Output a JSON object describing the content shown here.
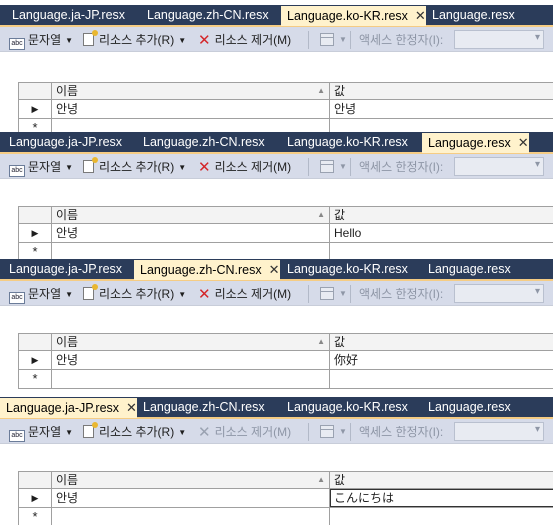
{
  "toolbar": {
    "strings_label": "문자열",
    "add_resource_label": "리소스 추가(R)",
    "remove_resource_label": "리소스 제거(M)",
    "access_modifier_label": "액세스 한정자(I):"
  },
  "grid": {
    "col_name": "이름",
    "col_value": "값",
    "new_row_marker": "*",
    "current_row_marker": "▶"
  },
  "panels": [
    {
      "tabs": [
        "Language.ja-JP.resx",
        "Language.zh-CN.resx",
        "Language.ko-KR.resx",
        "Language.resx"
      ],
      "active_tab": "Language.ko-KR.resx",
      "row": {
        "name": "안녕",
        "value": "안녕"
      },
      "remove_enabled": true
    },
    {
      "tabs": [
        "Language.ja-JP.resx",
        "Language.zh-CN.resx",
        "Language.ko-KR.resx",
        "Language.resx"
      ],
      "active_tab": "Language.resx",
      "row": {
        "name": "안녕",
        "value": "Hello"
      },
      "remove_enabled": true
    },
    {
      "tabs": [
        "Language.ja-JP.resx",
        "Language.zh-CN.resx",
        "Language.ko-KR.resx",
        "Language.resx"
      ],
      "active_tab": "Language.zh-CN.resx",
      "row": {
        "name": "안녕",
        "value": "你好"
      },
      "remove_enabled": true
    },
    {
      "tabs": [
        "Language.ja-JP.resx",
        "Language.zh-CN.resx",
        "Language.ko-KR.resx",
        "Language.resx"
      ],
      "active_tab": "Language.ja-JP.resx",
      "row": {
        "name": "안녕",
        "value": "こんにちは"
      },
      "remove_enabled": false
    }
  ],
  "colors": {
    "tabstrip_bg": "#2b3c5a",
    "active_tab_bg": "#fff2cc",
    "toolbar_bg": "#d6dbe9",
    "remove_icon": "#d4262a"
  },
  "icons": {
    "strings": "abc-icon",
    "add_resource": "new-resource-icon",
    "remove_resource": "delete-x-icon",
    "view": "grid-view-icon",
    "close": "close-icon",
    "current_row": "row-pointer-icon"
  }
}
